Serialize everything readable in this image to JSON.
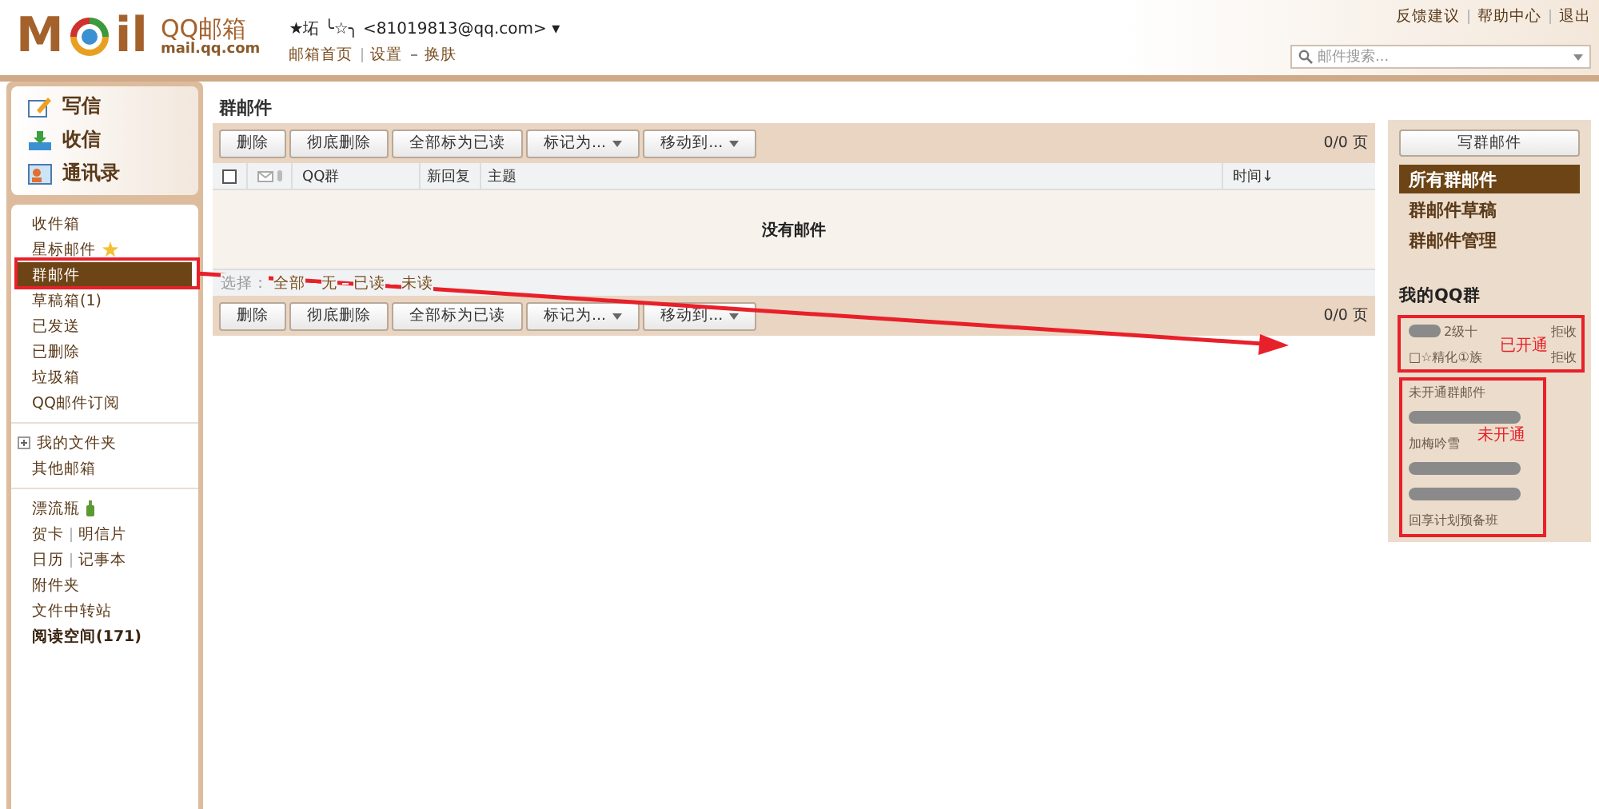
{
  "header": {
    "logo_left": "M",
    "logo_right": "il",
    "brand": "QQ邮箱",
    "domain": "mail.qq.com",
    "account": "★坧 ╰☆╮ <81019813@qq.com>",
    "account_caret": "▾",
    "links": [
      "邮箱首页",
      "设置",
      "换肤"
    ],
    "top_links": [
      "反馈建议",
      "帮助中心",
      "退出"
    ],
    "search": {
      "placeholder": "邮件搜索..."
    }
  },
  "sidebar": {
    "actions": [
      {
        "label": "写信",
        "kind": "write"
      },
      {
        "label": "收信",
        "kind": "receive"
      },
      {
        "label": "通讯录",
        "kind": "contacts"
      }
    ],
    "sections": [
      [
        {
          "labels": [
            "收件箱"
          ],
          "selected": false
        },
        {
          "labels": [
            "星标邮件"
          ],
          "selected": false,
          "kind": "star"
        },
        {
          "labels": [
            "群邮件"
          ],
          "selected": true
        },
        {
          "labels": [
            "草稿箱(1)"
          ],
          "selected": false
        },
        {
          "labels": [
            "已发送"
          ],
          "selected": false
        },
        {
          "labels": [
            "已删除"
          ],
          "selected": false
        },
        {
          "labels": [
            "垃圾箱"
          ],
          "selected": false
        },
        {
          "labels": [
            "QQ邮件订阅"
          ],
          "selected": false
        }
      ],
      [
        {
          "labels": [
            "我的文件夹"
          ],
          "selected": false,
          "kind": "folder"
        },
        {
          "labels": [
            "其他邮箱"
          ],
          "selected": false
        }
      ],
      [
        {
          "labels": [
            "漂流瓶"
          ],
          "selected": false,
          "kind": "bottle"
        },
        {
          "labels": [
            "贺卡",
            "明信片"
          ],
          "selected": false
        },
        {
          "labels": [
            "日历",
            "记事本"
          ],
          "selected": false
        },
        {
          "labels": [
            "附件夹"
          ],
          "selected": false
        },
        {
          "labels": [
            "文件中转站"
          ],
          "selected": false
        },
        {
          "labels": [
            "阅读空间(171)"
          ],
          "selected": false,
          "bold": true
        }
      ]
    ]
  },
  "main": {
    "title": "群邮件",
    "toolbar": [
      {
        "label": "删除"
      },
      {
        "label": "彻底删除"
      },
      {
        "label": "全部标为已读"
      },
      {
        "label": "标记为...",
        "dropdown": true
      },
      {
        "label": "移动到...",
        "dropdown": true
      }
    ],
    "pages": "0/0 页",
    "header_checkbox": {
      "checked": false
    },
    "columns": [
      "QQ群",
      "新回复",
      "主题",
      "时间↓"
    ],
    "empty": "没有邮件",
    "select_label": "选择：",
    "select_options": [
      "全部",
      "无",
      "已读",
      "未读"
    ],
    "bottom_toolbar": [
      {
        "label": "删除"
      },
      {
        "label": "彻底删除"
      },
      {
        "label": "全部标为已读"
      },
      {
        "label": "标记为...",
        "dropdown": true
      },
      {
        "label": "移动到...",
        "dropdown": true
      }
    ],
    "bottom_pages": "0/0 页"
  },
  "right": {
    "compose": "写群邮件",
    "menu": [
      {
        "label": "所有群邮件",
        "selected": true
      },
      {
        "label": "群邮件草稿",
        "selected": false
      },
      {
        "label": "群邮件管理",
        "selected": false
      }
    ],
    "groups_title": "我的QQ群",
    "opened": [
      {
        "name": "2级十",
        "redacted": true,
        "action": "拒收"
      },
      {
        "name": "□☆精化①族",
        "redacted": false,
        "action": "拒收"
      }
    ],
    "unopened_title": "未开通群邮件",
    "unopened": [
      {
        "redacted": true
      },
      {
        "name": "加梅吟雪",
        "redacted": false
      },
      {
        "redacted": true
      },
      {
        "redacted": true
      },
      {
        "name": "回享计划预备班",
        "redacted": false
      }
    ]
  },
  "annotations": {
    "opened_label": "已开通",
    "unopened_label": "未开通"
  }
}
